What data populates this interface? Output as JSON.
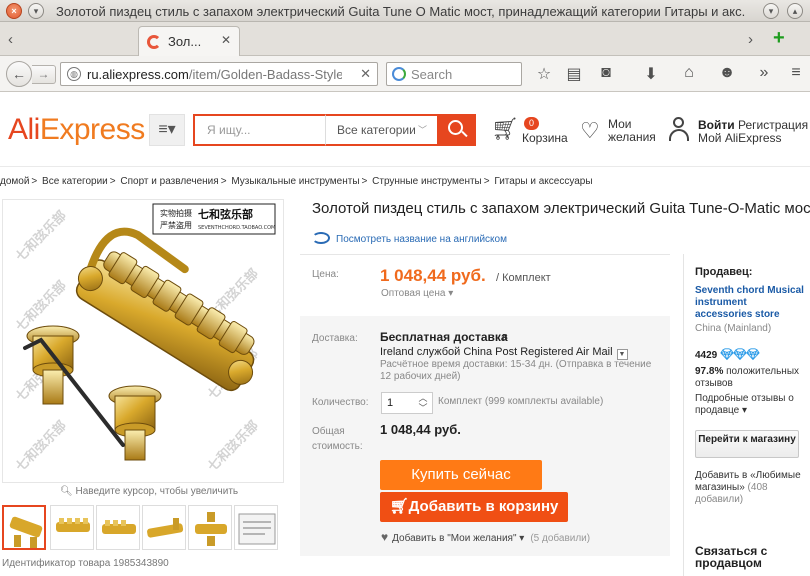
{
  "window": {
    "title": "Золотой пиздец стиль с запахом электрический Guita Tune O Matic мост, принадлежащий категории Гитары и акс..."
  },
  "tab": {
    "label": "Зол..."
  },
  "nav": {
    "url_domain": "ru.aliexpress.com",
    "url_path": "/item/Golden-Badass-Style",
    "search_placeholder": "Search"
  },
  "header": {
    "logo_ali": "AliExpress",
    "search_placeholder": "Я ищу...",
    "category_select": "Все категории",
    "cart_count": "0",
    "cart_label": "Корзина",
    "wishlist_line1": "Мои",
    "wishlist_line2": "желания",
    "login": "Войти",
    "register": "Регистрация",
    "my_account": "Мой AliExpress"
  },
  "breadcrumb": [
    "домой",
    "Все категории",
    "Спорт и развлечения",
    "Музыкальные инструменты",
    "Струнные инструменты",
    "Гитары и аксессуары"
  ],
  "gallery": {
    "watermark_en": "SEVENTHCHORD.TAOBAO.COM",
    "watermark_cn": "七和弦乐部",
    "badge_cn_1": "实物拍摄",
    "badge_cn_2": "严禁盗用",
    "zoom_hint": "Наведите курсор, чтобы увеличить",
    "item_id": "Идентификатор товара 1985343890"
  },
  "product": {
    "title": "Золотой пиздец стиль с запахом электрический Guita Tune-O-Matic мост",
    "translate_link": "Посмотреть название на английском",
    "price_label": "Цена:",
    "price": "1 048,44 руб.",
    "price_unit": "/ Комплект",
    "wholesale": "Оптовая цена",
    "shipping_label": "Доставка:",
    "shipping_title": "Бесплатная доставка",
    "shipping_in": "в",
    "shipping_line2": "Ireland службой China Post Registered Air Mail",
    "shipping_note": "Расчётное время доставки: 15-34 дн. (Отправка в течение 12 рабочих дней)",
    "qty_label": "Количество:",
    "qty_value": "1",
    "qty_note": "Комплект (999 комплекты available)",
    "total_label_1": "Общая",
    "total_label_2": "стоимость:",
    "total": "1 048,44 руб.",
    "buy_now": "Купить сейчас",
    "add_to_cart": "Добавить в корзину",
    "add_wish": "Добавить в \"Мои желания\"",
    "wish_count": "(5 добавили)"
  },
  "seller": {
    "heading": "Продавец:",
    "name": "Seventh chord Musical instrument accessories store",
    "country": "China (Mainland)",
    "score": "4429",
    "positive_pct": "97.8%",
    "positive_text": "положительных отзывов",
    "details": "Подробные отзывы о продавце",
    "store_button": "Перейти к магазину",
    "fav_text": "Добавить в «Любимые магазины»",
    "fav_count": "(408 добавили)",
    "contact": "Связаться с продавцом"
  },
  "colors": {
    "brand": "#e6461f",
    "price": "#f06a1d",
    "buy_button": "#ff7a15",
    "cart_button": "#f04f14",
    "link": "#2a6bb5"
  }
}
